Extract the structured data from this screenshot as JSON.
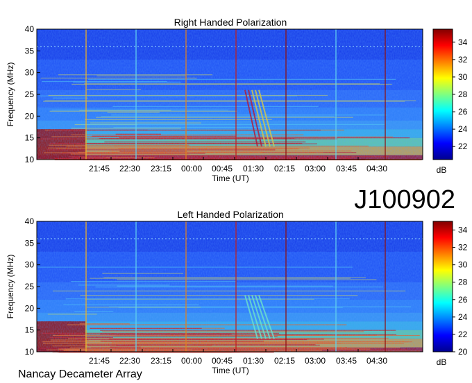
{
  "figure": {
    "event_id": "J100902",
    "footer": "Nancay Decameter Array"
  },
  "colors": {
    "background": "#ffffff",
    "colormap": "jet"
  },
  "chart_data": [
    {
      "type": "heatmap",
      "title": "Right Handed Polarization",
      "xlabel": "Time (UT)",
      "ylabel": "Frequency (MHz)",
      "colorbar_label": "dB",
      "x_ticks": [
        "21:45",
        "22:30",
        "23:15",
        "00:00",
        "00:45",
        "01:30",
        "02:15",
        "03:00",
        "03:45",
        "04:30"
      ],
      "y_ticks": [
        10,
        15,
        20,
        25,
        30,
        35,
        40
      ],
      "ylim": [
        10,
        40
      ],
      "colorbar_ticks": [
        22,
        24,
        26,
        28,
        30,
        32,
        34
      ],
      "colorbar_range": [
        20.5,
        35.5
      ],
      "grid": false
    },
    {
      "type": "heatmap",
      "title": "Left Handed Polarization",
      "xlabel": "Time (UT)",
      "ylabel": "Frequency (MHz)",
      "colorbar_label": "dB",
      "x_ticks": [
        "21:45",
        "22:30",
        "23:15",
        "00:00",
        "00:45",
        "01:30",
        "02:15",
        "03:00",
        "03:45",
        "04:30"
      ],
      "y_ticks": [
        10,
        15,
        20,
        25,
        30,
        35,
        40
      ],
      "ylim": [
        10,
        40
      ],
      "colorbar_ticks": [
        20,
        22,
        24,
        26,
        28,
        30,
        32,
        34
      ],
      "colorbar_range": [
        20,
        35
      ],
      "grid": false
    }
  ]
}
